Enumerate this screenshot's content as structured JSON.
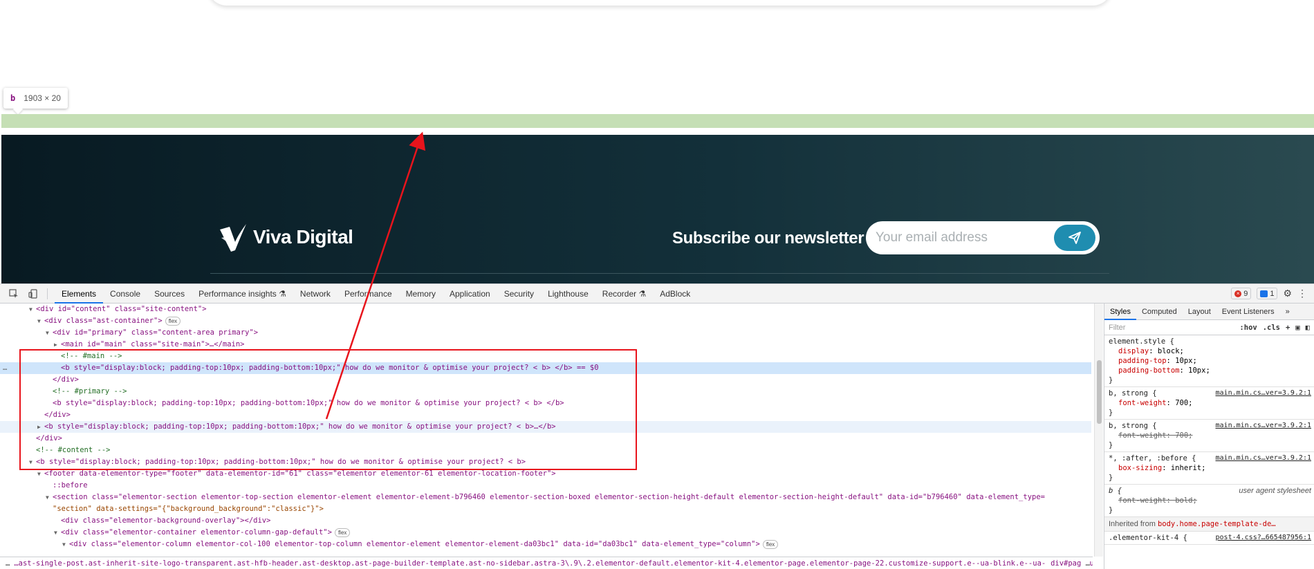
{
  "tooltip": {
    "tag": "b",
    "dims": "1903 × 20"
  },
  "footer": {
    "logo_text": "Viva Digital",
    "newsletter_title": "Subscribe our newsletter",
    "email_placeholder": "Your email address",
    "colors": {
      "button": "#1f8db0",
      "highlight": "#c5dfb5"
    }
  },
  "devtools": {
    "tabs": [
      "Elements",
      "Console",
      "Sources",
      "Performance insights",
      "Network",
      "Performance",
      "Memory",
      "Application",
      "Security",
      "Lighthouse",
      "Recorder",
      "AdBlock"
    ],
    "active_tab": "Elements",
    "errors_count": "9",
    "messages_count": "1",
    "dom_lines": [
      "<div id=\"content\" class=\"site-content\">",
      "<div class=\"ast-container\">",
      "<div id=\"primary\" class=\"content-area primary\">",
      "<main id=\"main\" class=\"site-main\">…</main>",
      "<!-- #main -->",
      "<b style=\"display:block; padding-top:10px; padding-bottom:10px;\" how do we monitor & optimise your project? < b> </b> == $0",
      "</div>",
      "<!-- #primary -->",
      "<b style=\"display:block; padding-top:10px; padding-bottom:10px;\" how do we monitor & optimise your project? < b> </b>",
      "</div>",
      "<b style=\"display:block; padding-top:10px; padding-bottom:10px;\" how do we monitor & optimise your project? < b>…</b>",
      "</div>",
      "<!-- #content -->",
      "<b style=\"display:block; padding-top:10px; padding-bottom:10px;\" how do we monitor & optimise your project? < b>",
      "<footer data-elementor-type=\"footer\" data-elementor-id=\"61\" class=\"elementor elementor-61 elementor-location-footer\">",
      "::before",
      "<section class=\"elementor-section elementor-top-section elementor-element elementor-element-b796460 elementor-section-boxed elementor-section-height-default elementor-section-height-default\" data-id=\"b796460\" data-element_type=",
      "\"section\" data-settings=\"{\"background_background\":\"classic\"}\">",
      "<div class=\"elementor-background-overlay\"></div>",
      "<div class=\"elementor-container elementor-column-gap-default\">",
      "<div class=\"elementor-column elementor-col-100 elementor-top-column elementor-element elementor-element-da03bc1\" data-id=\"da03bc1\" data-element_type=\"column\">"
    ],
    "flex_label": "flex",
    "breadcrumb": "…ast-single-post.ast-inherit-site-logo-transparent.ast-hfb-header.ast-desktop.ast-page-builder-template.ast-no-sidebar.astra-3\\.9\\.2.elementor-default.elementor-kit-4.elementor-page.elementor-page-22.customize-support.e--ua-blink.e--ua-chrome.e--ua-webkit.ast-mouse-clicked",
    "breadcrumb_tail": "div#pag",
    "styles": {
      "tabs": [
        "Styles",
        "Computed",
        "Layout",
        "Event Listeners"
      ],
      "filter_placeholder": "Filter",
      "hov": ":hov",
      "cls": ".cls",
      "rules": [
        {
          "selector": "element.style {",
          "source": "",
          "decls": [
            "display: block;",
            "padding-top: 10px;",
            "padding-bottom: 10px;"
          ]
        },
        {
          "selector": "b, strong {",
          "source": "main.min.cs…ver=3.9.2:1",
          "decls": [
            "font-weight: 700;"
          ]
        },
        {
          "selector": "b, strong {",
          "source": "main.min.cs…ver=3.9.2:1",
          "decls": [
            "font-weight: 700;"
          ]
        },
        {
          "selector": "*, :after, :before {",
          "source": "main.min.cs…ver=3.9.2:1",
          "decls": [
            "box-sizing: inherit;"
          ]
        },
        {
          "selector": "b {",
          "source": "user agent stylesheet",
          "decls": [
            "font-weight: bold;"
          ]
        }
      ],
      "inherited_label": "Inherited from",
      "inherited_selector": "body.home.page-template-de…",
      "last_selector": ".elementor-kit-4 {",
      "last_source": "post-4.css?…665487956:1"
    }
  }
}
